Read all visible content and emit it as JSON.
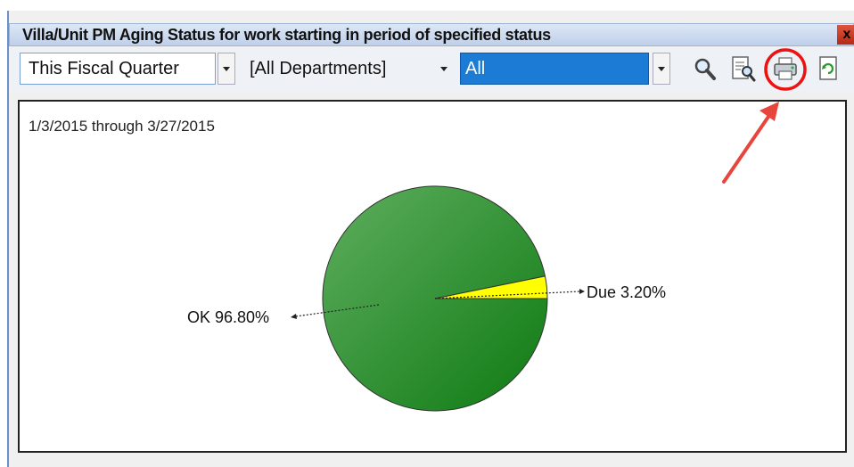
{
  "window": {
    "title": "Villa/Unit PM Aging Status for work starting in period of specified status",
    "close_glyph": "x"
  },
  "filters": {
    "period": "This Fiscal Quarter",
    "department": "[All Departments]",
    "status": "All"
  },
  "toolbar_icons": [
    "search-icon",
    "preview-icon",
    "print-icon",
    "refresh-icon"
  ],
  "chart": {
    "date_range": "1/3/2015 through 3/27/2015"
  },
  "chart_data": {
    "type": "pie",
    "slices": [
      {
        "label": "OK 96.80%",
        "name": "OK",
        "value": 96.8,
        "color": "#1e8c1e"
      },
      {
        "label": "Due 3.20%",
        "name": "Due",
        "value": 3.2,
        "color": "#ffff00"
      }
    ]
  },
  "colors": {
    "accent": "#6d8fc8",
    "highlight": "#1c7cd5",
    "annotation": "#e8453c"
  }
}
